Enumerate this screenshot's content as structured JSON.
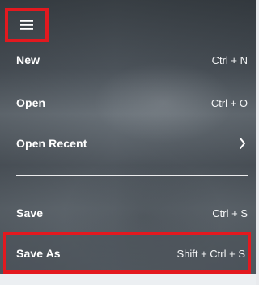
{
  "window": {
    "type": "hamburger-menu"
  },
  "menu": {
    "icon": "hamburger-icon",
    "items": [
      {
        "label": "New",
        "shortcut": "Ctrl + N"
      },
      {
        "label": "Open",
        "shortcut": "Ctrl + O"
      },
      {
        "label": "Open Recent",
        "submenu_icon": "chevron-right-icon"
      },
      {
        "label": "Save",
        "shortcut": "Ctrl + S"
      },
      {
        "label": "Save As",
        "shortcut": "Shift + Ctrl + S"
      }
    ]
  },
  "colors": {
    "highlight": "#e3191f",
    "text": "#ffffff",
    "divider": "#f2f3f4"
  }
}
